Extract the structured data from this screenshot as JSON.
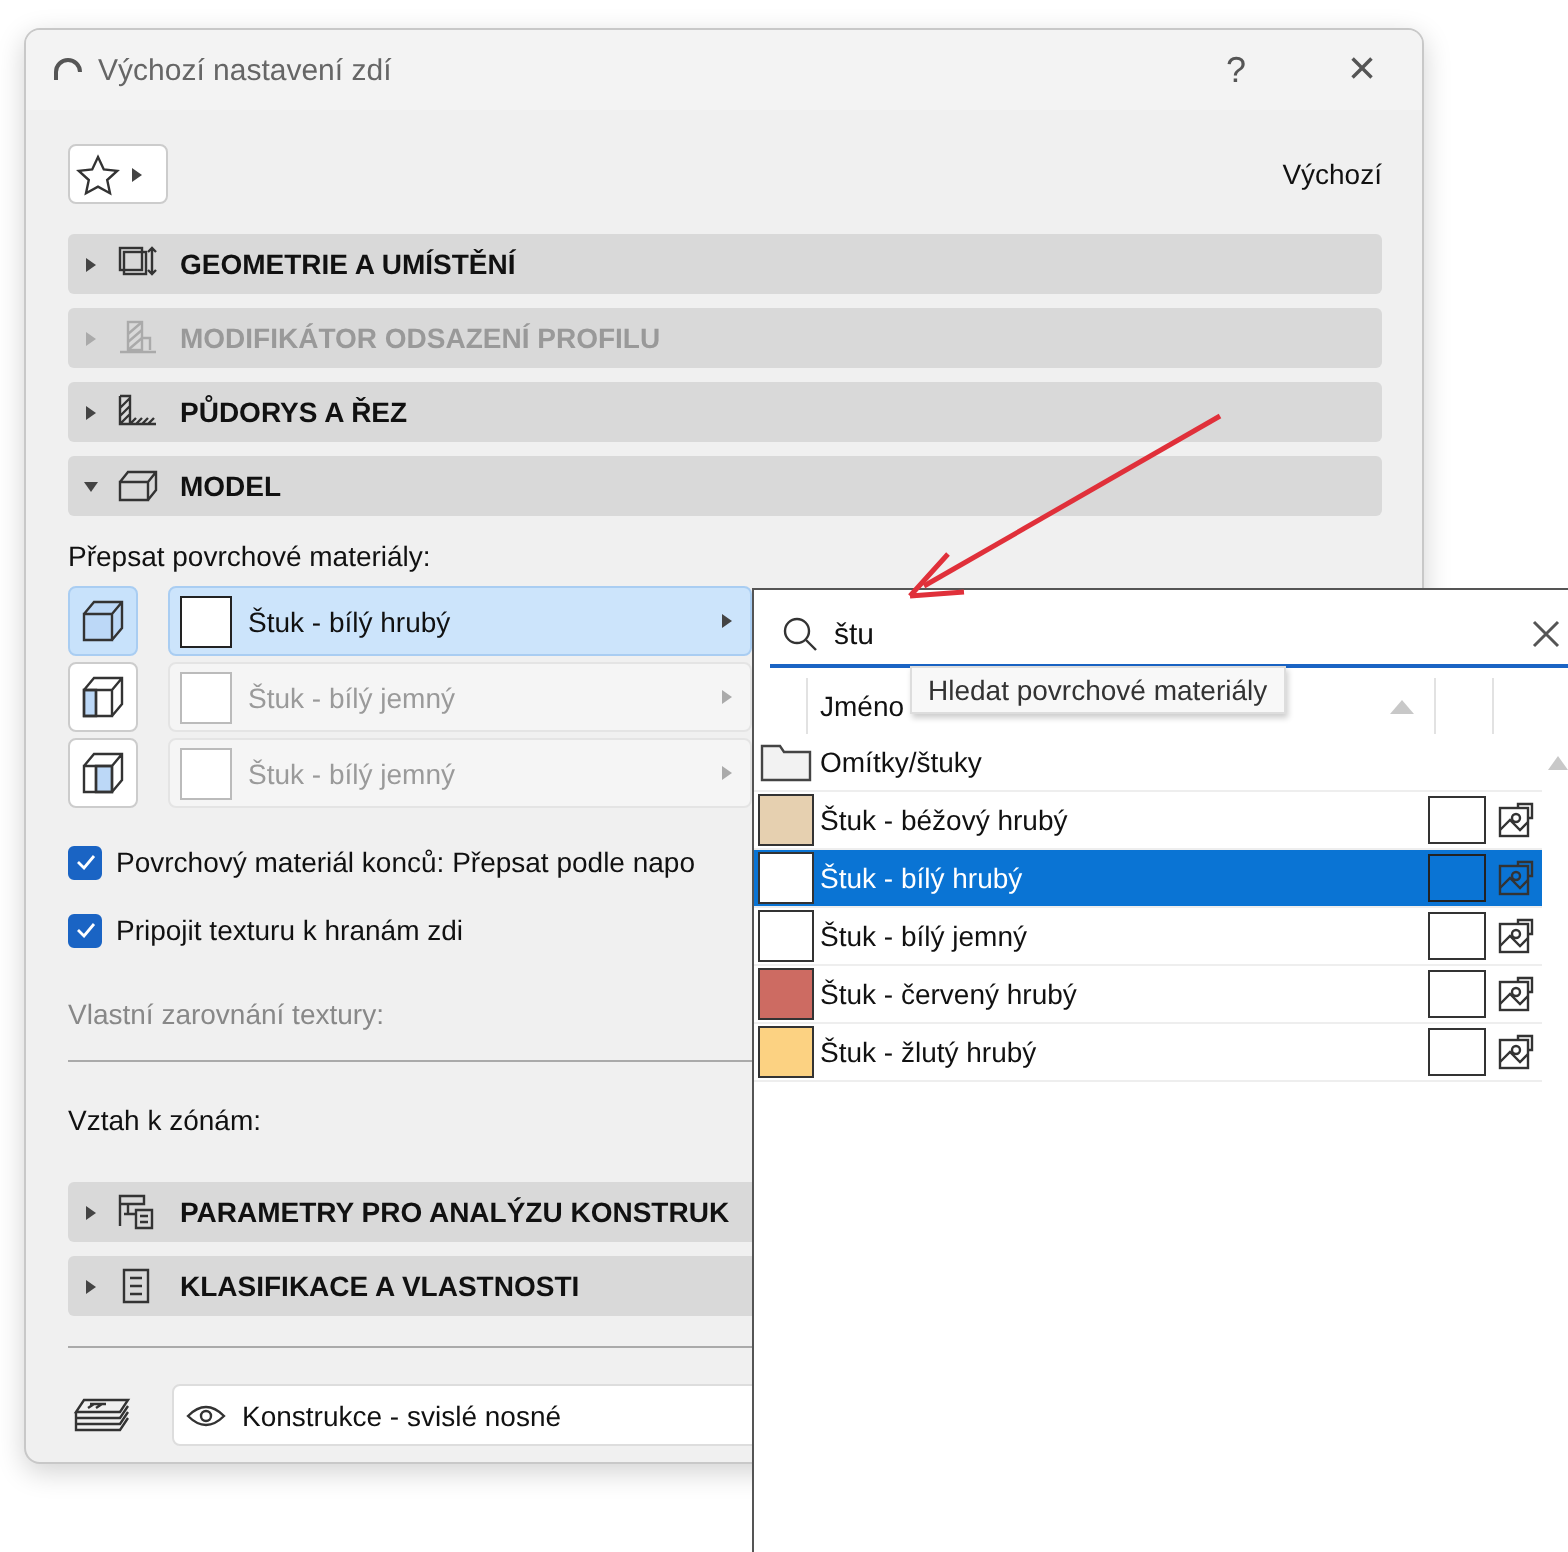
{
  "window": {
    "title": "Výchozí nastavení zdí",
    "help": "?",
    "close": "×"
  },
  "favorites": {
    "default_label": "Výchozí"
  },
  "sections": [
    {
      "title": "GEOMETRIE A UMÍSTĚNÍ",
      "kind": "geometry",
      "expanded": false,
      "disabled": false
    },
    {
      "title": "MODIFIKÁTOR ODSAZENÍ PROFILU",
      "kind": "profile",
      "expanded": false,
      "disabled": true
    },
    {
      "title": "PŮDORYS A ŘEZ",
      "kind": "floorplan",
      "expanded": false,
      "disabled": false
    },
    {
      "title": "MODEL",
      "kind": "model",
      "expanded": true,
      "disabled": false
    }
  ],
  "model": {
    "override_label": "Přepsat povrchové materiály:",
    "materials": [
      {
        "kind": "top",
        "name": "Štuk - bílý hrubý",
        "color": "#ffffff",
        "selected": true,
        "disabled": false
      },
      {
        "kind": "left",
        "name": "Štuk - bílý jemný",
        "color": "#ffffff",
        "selected": false,
        "disabled": true
      },
      {
        "kind": "right",
        "name": "Štuk - bílý jemný",
        "color": "#ffffff",
        "selected": false,
        "disabled": true
      }
    ],
    "checkboxes": [
      {
        "label": "Povrchový materiál konců: Přepsat podle napo",
        "checked": true
      },
      {
        "label": "Pripojit texturu k hranám zdi",
        "checked": true
      }
    ],
    "texture_alignment_label": "Vlastní zarovnání textury:",
    "zones_label": "Vztah k zónám:"
  },
  "more_sections": [
    {
      "title": "PARAMETRY PRO ANALÝZU KONSTRUK",
      "kind": "analysis",
      "expanded": false,
      "disabled": false
    },
    {
      "title": "KLASIFIKACE A VLASTNOSTI",
      "kind": "classification",
      "expanded": false,
      "disabled": false
    }
  ],
  "layer": {
    "value": "Konstrukce - svislé nosné"
  },
  "picker": {
    "search": {
      "value": "štu"
    },
    "tooltip": "Hledat povrchové materiály",
    "columns": [
      "Jméno"
    ],
    "folder": "Omítky/štuky",
    "items": [
      {
        "name": "Štuk - béžový hrubý",
        "color": "#e6d0b0",
        "selected": false
      },
      {
        "name": "Štuk - bílý hrubý",
        "color": "#ffffff",
        "selected": true
      },
      {
        "name": "Štuk - bílý jemný",
        "color": "#ffffff",
        "selected": false
      },
      {
        "name": "Štuk - červený hrubý",
        "color": "#cd6b62",
        "selected": false
      },
      {
        "name": "Štuk - žlutý hrubý",
        "color": "#fcd282",
        "selected": false
      }
    ]
  }
}
